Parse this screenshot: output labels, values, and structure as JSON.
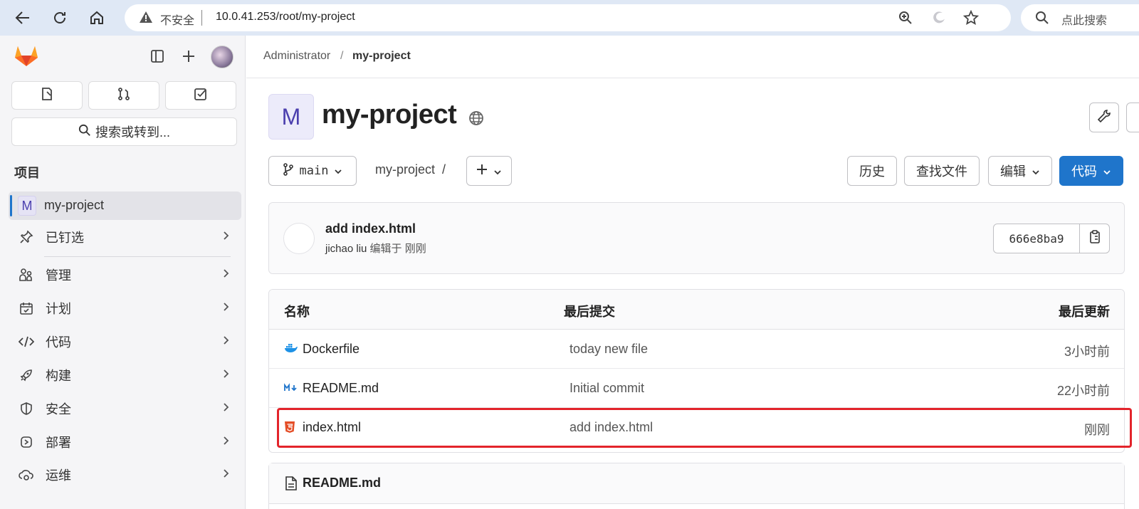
{
  "browser": {
    "insecure_label": "不安全",
    "url": "10.0.41.253/root/my-project",
    "search_placeholder": "点此搜索"
  },
  "sidebar": {
    "search_label": "搜索或转到...",
    "section_title": "项目",
    "active_project": {
      "avatar_letter": "M",
      "label": "my-project"
    },
    "items": [
      {
        "label": "已钉选",
        "icon": "pin-icon"
      },
      {
        "label": "管理",
        "icon": "users-icon"
      },
      {
        "label": "计划",
        "icon": "calendar-icon"
      },
      {
        "label": "代码",
        "icon": "code-icon"
      },
      {
        "label": "构建",
        "icon": "rocket-icon"
      },
      {
        "label": "安全",
        "icon": "shield-icon"
      },
      {
        "label": "部署",
        "icon": "deploy-icon"
      },
      {
        "label": "运维",
        "icon": "cloud-gear-icon"
      }
    ]
  },
  "breadcrumb": {
    "parent": "Administrator",
    "separator": "/",
    "current": "my-project"
  },
  "project": {
    "avatar_letter": "M",
    "title": "my-project"
  },
  "toolbar": {
    "branch": "main",
    "path": "my-project",
    "path_sep": "/",
    "history": "历史",
    "find_file": "查找文件",
    "edit": "编辑",
    "code": "代码"
  },
  "commit": {
    "title": "add index.html",
    "author": "jichao liu",
    "meta": "编辑于 刚刚",
    "sha": "666e8ba9"
  },
  "files": {
    "headers": {
      "name": "名称",
      "last_commit": "最后提交",
      "last_update": "最后更新"
    },
    "rows": [
      {
        "name": "Dockerfile",
        "icon": "docker-icon",
        "message": "today new file",
        "updated": "3小时前"
      },
      {
        "name": "README.md",
        "icon": "markdown-icon",
        "message": "Initial commit",
        "updated": "22小时前"
      },
      {
        "name": "index.html",
        "icon": "html5-icon",
        "message": "add index.html",
        "updated": "刚刚"
      }
    ]
  },
  "readme": {
    "title": "README.md"
  },
  "colors": {
    "accent": "#1f75cb",
    "highlight": "#e3242b",
    "gitlab_orange": "#fc6d26"
  }
}
